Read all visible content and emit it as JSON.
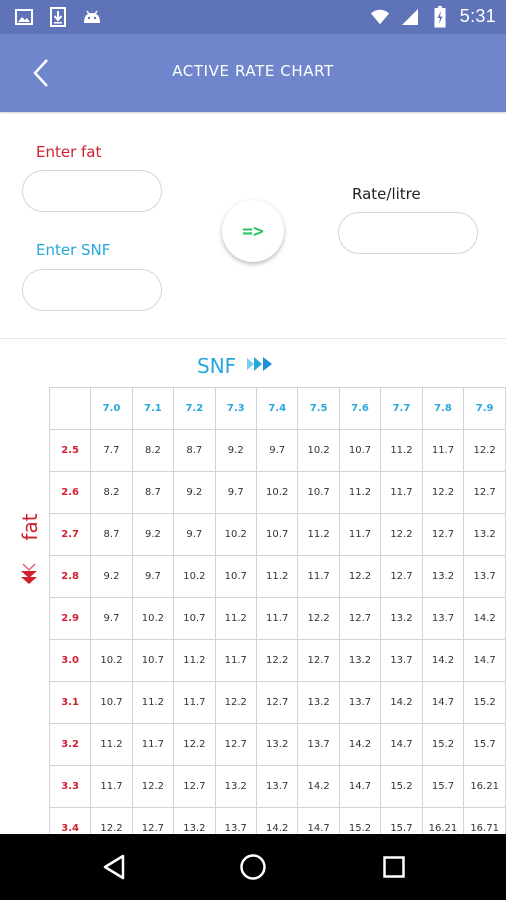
{
  "status_bar": {
    "time": "5:31",
    "left_icons": [
      "image-icon",
      "download-icon",
      "android-icon"
    ],
    "right_icons": [
      "wifi-icon",
      "signal-icon",
      "battery-icon"
    ]
  },
  "app_bar": {
    "title": "ACTIVE RATE CHART",
    "back_icon": "back-chevron-icon",
    "color": "#6f86cd"
  },
  "form": {
    "fat_label": "Enter fat",
    "snf_label": "Enter SNF",
    "rate_label": "Rate/litre",
    "fat_value": "",
    "snf_value": "",
    "rate_value": "",
    "go_button_label": "=>",
    "fat_color": "#d01f2f",
    "snf_color": "#27a8dd",
    "go_color": "#28c463"
  },
  "chart": {
    "snf_header": "SNF",
    "fat_header": "fat",
    "snf_values": [
      "7.0",
      "7.1",
      "7.2",
      "7.3",
      "7.4",
      "7.5",
      "7.6",
      "7.7",
      "7.8",
      "7.9"
    ],
    "rows": [
      {
        "fat": "2.5",
        "rates": [
          "7.7",
          "8.2",
          "8.7",
          "9.2",
          "9.7",
          "10.2",
          "10.7",
          "11.2",
          "11.7",
          "12.2"
        ]
      },
      {
        "fat": "2.6",
        "rates": [
          "8.2",
          "8.7",
          "9.2",
          "9.7",
          "10.2",
          "10.7",
          "11.2",
          "11.7",
          "12.2",
          "12.7"
        ]
      },
      {
        "fat": "2.7",
        "rates": [
          "8.7",
          "9.2",
          "9.7",
          "10.2",
          "10.7",
          "11.2",
          "11.7",
          "12.2",
          "12.7",
          "13.2"
        ]
      },
      {
        "fat": "2.8",
        "rates": [
          "9.2",
          "9.7",
          "10.2",
          "10.7",
          "11.2",
          "11.7",
          "12.2",
          "12.7",
          "13.2",
          "13.7"
        ]
      },
      {
        "fat": "2.9",
        "rates": [
          "9.7",
          "10.2",
          "10.7",
          "11.2",
          "11.7",
          "12.2",
          "12.7",
          "13.2",
          "13.7",
          "14.2"
        ]
      },
      {
        "fat": "3.0",
        "rates": [
          "10.2",
          "10.7",
          "11.2",
          "11.7",
          "12.2",
          "12.7",
          "13.2",
          "13.7",
          "14.2",
          "14.7"
        ]
      },
      {
        "fat": "3.1",
        "rates": [
          "10.7",
          "11.2",
          "11.7",
          "12.2",
          "12.7",
          "13.2",
          "13.7",
          "14.2",
          "14.7",
          "15.2"
        ]
      },
      {
        "fat": "3.2",
        "rates": [
          "11.2",
          "11.7",
          "12.2",
          "12.7",
          "13.2",
          "13.7",
          "14.2",
          "14.7",
          "15.2",
          "15.7"
        ]
      },
      {
        "fat": "3.3",
        "rates": [
          "11.7",
          "12.2",
          "12.7",
          "13.2",
          "13.7",
          "14.2",
          "14.7",
          "15.2",
          "15.7",
          "16.21"
        ]
      },
      {
        "fat": "3.4",
        "rates": [
          "12.2",
          "12.7",
          "13.2",
          "13.7",
          "14.2",
          "14.7",
          "15.2",
          "15.7",
          "16.21",
          "16.71"
        ]
      }
    ]
  },
  "nav_bar": {
    "buttons": [
      "back-triangle-icon",
      "home-circle-icon",
      "recents-square-icon"
    ]
  }
}
